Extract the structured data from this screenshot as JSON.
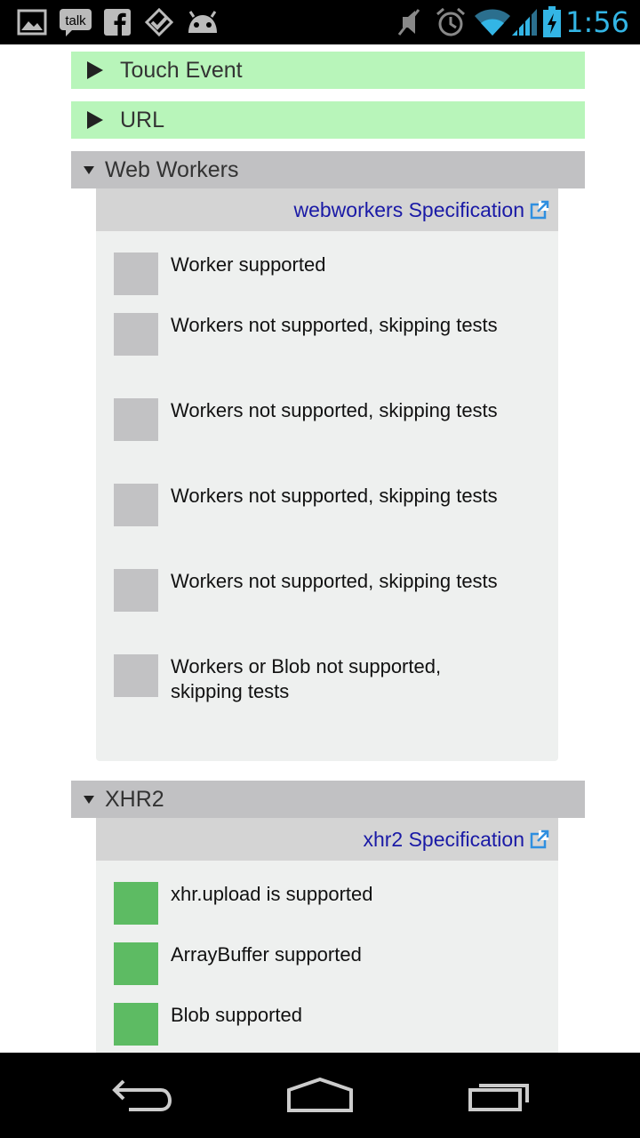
{
  "status_bar": {
    "time": "1:56",
    "left_icons": [
      "gallery-icon",
      "talk-icon",
      "facebook-icon",
      "task-check-icon",
      "android-icon"
    ],
    "right_icons": [
      "mute-icon",
      "alarm-icon",
      "wifi-icon",
      "signal-icon",
      "battery-charging-icon"
    ],
    "talk_text": "talk",
    "accent_color": "#33b5e5"
  },
  "sections": {
    "touch_event": {
      "title": "Touch Event"
    },
    "url": {
      "title": "URL"
    },
    "web_workers": {
      "title": "Web Workers",
      "spec_link": "webworkers Specification",
      "items": [
        {
          "label": "Worker supported",
          "status": "unknown"
        },
        {
          "label": "Workers not supported, skipping tests",
          "status": "unknown"
        },
        {
          "label": "Workers not supported, skipping tests",
          "status": "unknown"
        },
        {
          "label": "Workers not supported, skipping tests",
          "status": "unknown"
        },
        {
          "label": "Workers not supported, skipping tests",
          "status": "unknown"
        },
        {
          "label": "Workers or Blob not supported, skipping tests",
          "status": "unknown"
        }
      ]
    },
    "xhr2": {
      "title": "XHR2",
      "spec_link": "xhr2 Specification",
      "items": [
        {
          "label": "xhr.upload is supported",
          "status": "supported"
        },
        {
          "label": "ArrayBuffer supported",
          "status": "supported"
        },
        {
          "label": "Blob supported",
          "status": "supported"
        }
      ]
    }
  },
  "colors": {
    "collapsed_section_bg": "#b8f5ba",
    "expanded_section_bg": "#c1c1c3",
    "supported": "#5dbb63",
    "unknown": "#c2c2c4",
    "link": "#1a1aa6"
  },
  "nav_bar": {
    "icons": [
      "back-icon",
      "home-icon",
      "recent-apps-icon"
    ]
  }
}
